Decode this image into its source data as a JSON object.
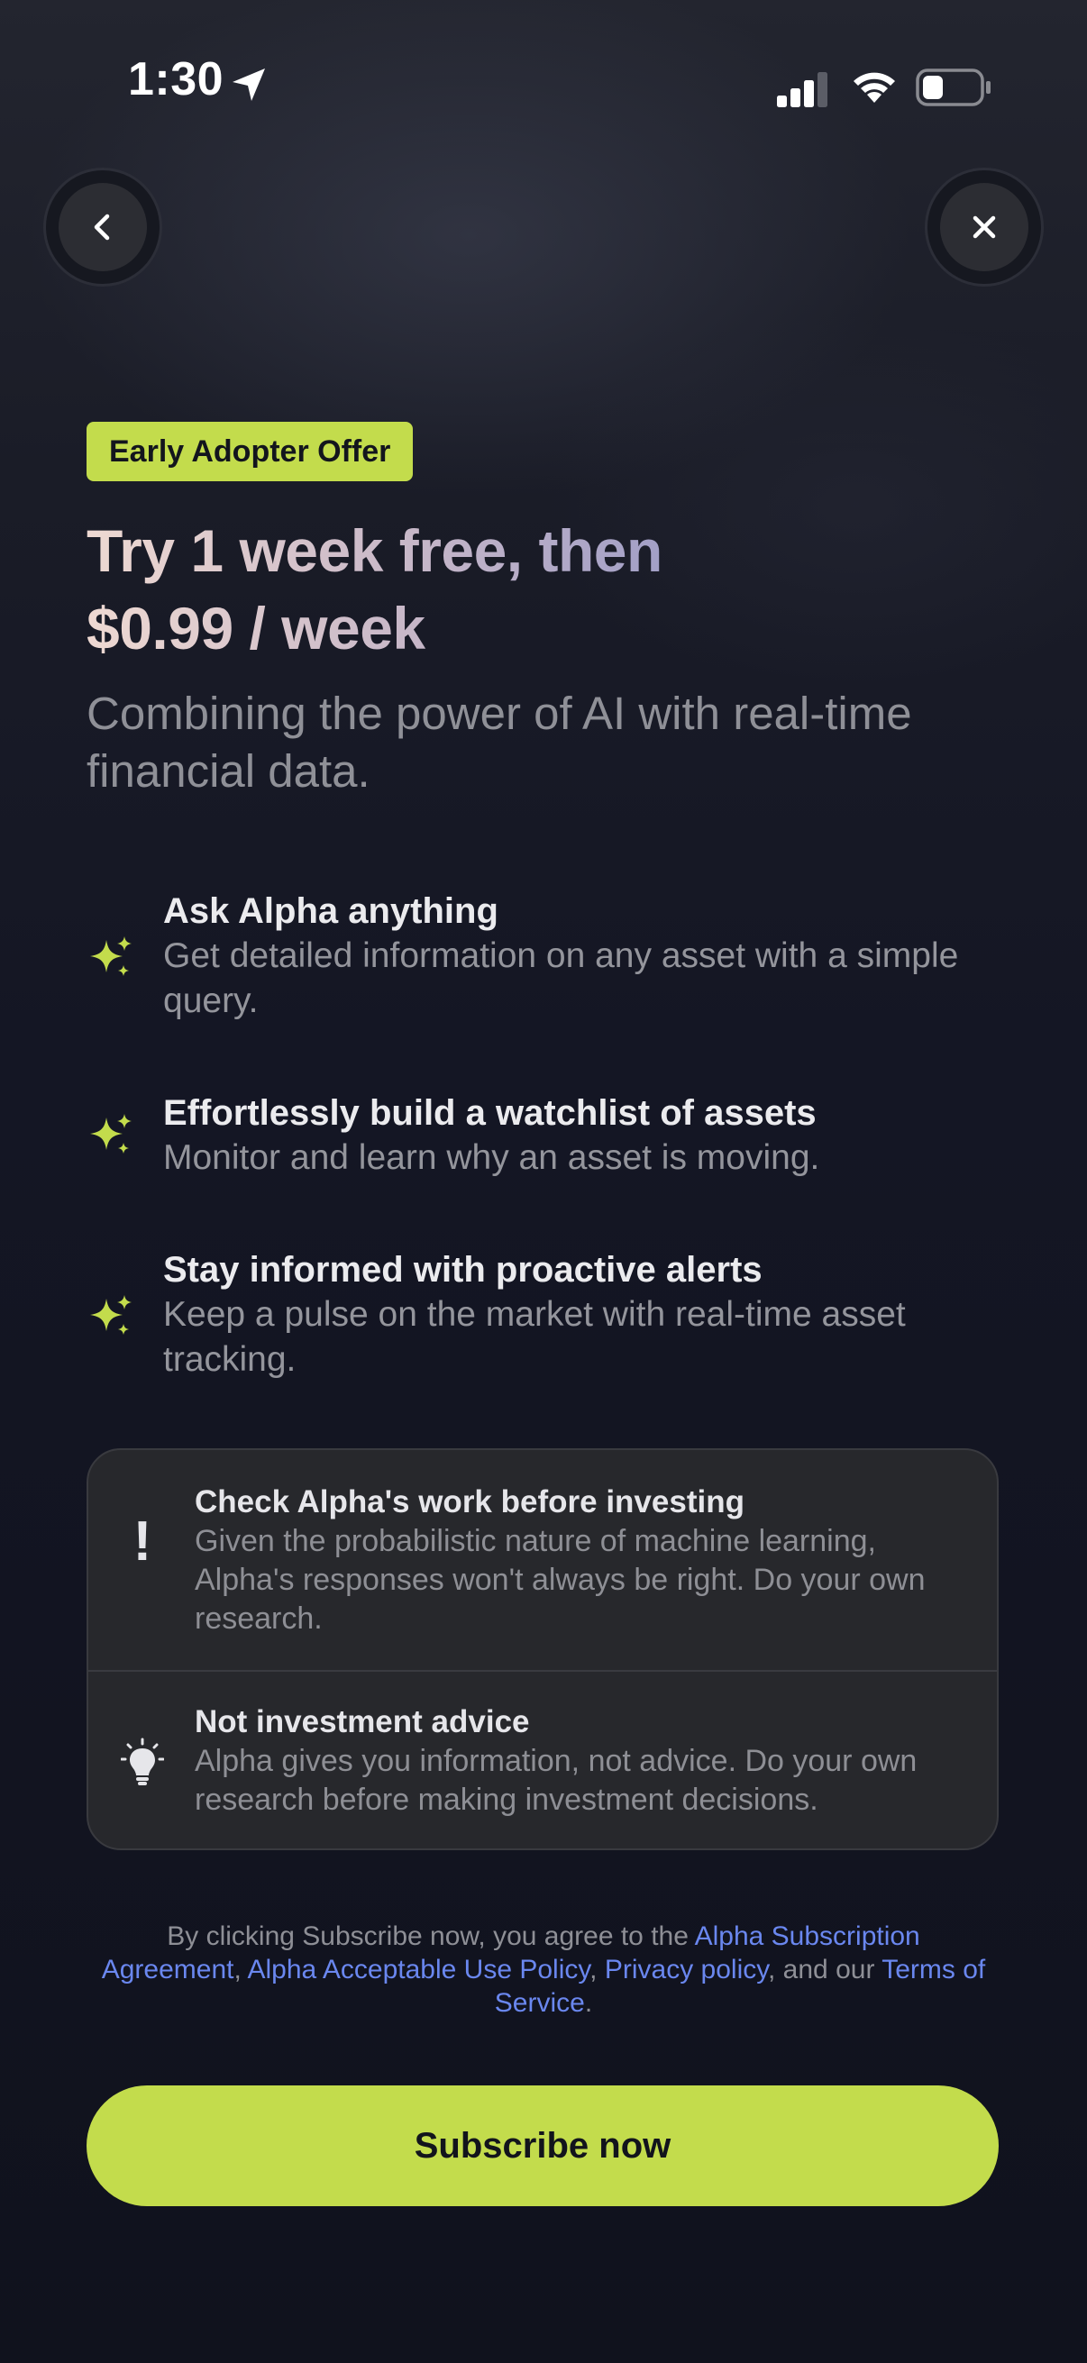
{
  "status_bar": {
    "time": "1:30"
  },
  "nav": {
    "back_icon": "chevron-left-icon",
    "close_icon": "close-icon"
  },
  "offer": {
    "badge": "Early Adopter Offer",
    "headline_line1": "Try 1 week free, then",
    "headline_line2": "$0.99 / week",
    "subheadline": "Combining the power of AI with real-time financial data."
  },
  "features": [
    {
      "icon": "sparkles-icon",
      "title": "Ask Alpha anything",
      "description": "Get detailed information on any asset with a simple query."
    },
    {
      "icon": "sparkles-icon",
      "title": "Effortlessly build a watchlist of assets",
      "description": "Monitor and learn why an asset is moving."
    },
    {
      "icon": "sparkles-icon",
      "title": "Stay informed with proactive alerts",
      "description": "Keep a pulse on the market with real-time asset tracking."
    }
  ],
  "disclaimers": [
    {
      "icon": "exclamation-icon",
      "title": "Check Alpha's work before investing",
      "description": "Given the probabilistic nature of machine learning, Alpha's responses won't always be right. Do your own research."
    },
    {
      "icon": "lightbulb-icon",
      "title": "Not investment advice",
      "description": "Alpha gives you information, not advice. Do your own research before making investment decisions."
    }
  ],
  "legal": {
    "prefix": "By clicking Subscribe now, you agree to the ",
    "link_agreement": "Alpha Subscription Agreement",
    "sep1": ", ",
    "link_aup": "Alpha Acceptable Use Policy",
    "sep2": ", ",
    "link_privacy": "Privacy policy",
    "sep3": ", and our ",
    "link_terms": "Terms of Service",
    "suffix": "."
  },
  "cta": {
    "label": "Subscribe now"
  },
  "colors": {
    "accent": "#c3dc4c",
    "link": "#6a87ef",
    "background": "#111320"
  }
}
